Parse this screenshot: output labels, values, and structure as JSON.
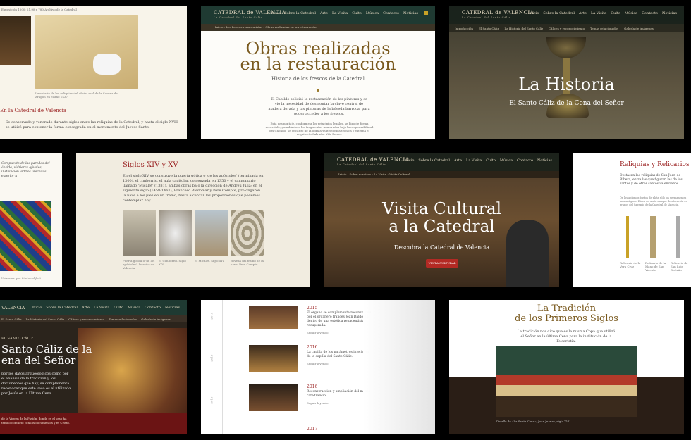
{
  "t1": {
    "crumb": "Exposición 1500: 21.98 x 780 Archivo de la Catedral",
    "heading": "En la Catedral de Valencia",
    "para": "Se conservado y venerado durante siglos entre las reliquias de la Catedral, y hasta el siglo XVIII se utilizó para contener la forma consagrada en el monumento del Jueves Santo.",
    "caption": "Inventario de las reliquias del oficial real de la Corona de Aragón en el año 1437"
  },
  "nav": {
    "logo": "CATEDRAL de VALENCIA",
    "tag": "La Catedral del Santo Cáliz",
    "items": [
      "Inicio",
      "Sobre la Catedral",
      "Arte",
      "La Visita",
      "Culto",
      "Música",
      "Contacto",
      "Noticias"
    ]
  },
  "t2": {
    "crumb": "Inicio › Los frescos renacentistas › Obras realizadas en la restauración",
    "title1": "Obras realizadas",
    "title2": "en la restauración",
    "sub": "Historia de los frescos de la Catedral",
    "p1": "El Cabildo solicitó la restauración de las pinturas y se vio la necesidad de desmontar la clave central de madera dorada y las pinturas de la bóveda barroca, para poder acceder a los frescos.",
    "p2": "Esta desmontaje, conforme a los principios legales, se hizo de forma reversible, guardándose los fragmentos numerados bajo la responsabilidad del Cabildo. Se encargó de la obra arquitectónica técnica y externa el arquitecto Salvador Vila Ferrer."
  },
  "t3": {
    "tabs": [
      "Introducción",
      "El Santo Cáliz",
      "La Historia del Santo Cáliz",
      "Cálices y reconocimiento",
      "Temas relacionados",
      "Galería de imágenes"
    ],
    "title": "La Historia",
    "sub": "El Santo Cáliz de la Cena del Señor"
  },
  "t4": {
    "para": "Compuesto de las paredes del ábside, vidrieras ojivales, instalación vidrios ubicados exterior a",
    "caption": "Vidrieras que Silvia calificó."
  },
  "t5": {
    "title": "Siglos XIV y XV",
    "para": "En el siglo XIV se construye la puerta gótica o 'de los apóstoles' (terminada en 1300), el cimborrio, el aula capitular, comenzada en 1350 y el campanario llamado 'Micalet' (1381), ambas obras bajo la dirección de Andreu Julià; en el siguiente siglo (1458-1467), Francesc Baldomar y Pere Compte, prolongaron la nave a los pies en un tramo, hasta alcanzar las proporciones que podemos contemplar hoy.",
    "captions": [
      "Puerta gótica o 'de los apóstoles'. Interior de Valencia",
      "El Cimborrio. Siglo XIV",
      "El Micalet. Siglo XIV",
      "Bóveda del tramo de la nave. Pere Compte"
    ]
  },
  "t6": {
    "crumb": "Inicio › Sobre nosotros › La Visita › Visita Cultural",
    "title1": "Visita Cultural",
    "title2": "a la Catedral",
    "sub": "Descubra la Catedral de Valencia",
    "button": "VISITA CULTURAL"
  },
  "t7": {
    "title": "Reliquias y Relicarios",
    "para": "Destacan las reliquias de San Juan de Ribera, entre las que figuran las de los santos y de otros santos valencianos.",
    "para2": "De los antiguos bustos de plata sólo los permanentes más antiguos. Dicen un santo aunque de ubicación en granos del Sagrario de la Catedral de Valencia.",
    "captions": [
      "Relicario de la Vera Cruz",
      "Relicario de la Mano de San Vicente",
      "Relicario de San Luis Bertrán"
    ]
  },
  "t8": {
    "logo": "VALENCIA",
    "items": [
      "Inicio",
      "Sobre la Catedral",
      "Arte",
      "La Visita",
      "Culto",
      "Música",
      "Contacto",
      "Noticias"
    ],
    "tabs": [
      "El Santo Cáliz",
      "La Historia del Santo Cáliz",
      "Cálices y reconocimiento",
      "Temas relacionados",
      "Galería de imágenes"
    ],
    "kicker": "EL SANTO CÁLIZ",
    "title1": "Santo Cáliz de la",
    "title2": "ena del Señor",
    "para": "por los datos arqueológicos como por el análisis de la tradición y los documentos que hay, se complementa reconocer que este vaso es el utilizado por Jesús en la Última Cena.",
    "para2": "de la Virgen de la Pasión, donde es el vaso ha tenido contacto con los documentos y es Cristo."
  },
  "t9": {
    "years": [
      "2015",
      "2016",
      "2016",
      "2017"
    ],
    "side": [
      "2015",
      "2016",
      "2016"
    ],
    "items": [
      {
        "year": "2015",
        "text": "El órgano se complementa reconstruido por el organero francés Jean Daldosso dentro de una estética renacentista recuperada."
      },
      {
        "year": "2016",
        "text": "La capilla de los parámetros interiores de la capilla del Santo Cáliz."
      },
      {
        "year": "2016",
        "text": "Reconstrucción y ampliación del museo catedralicio."
      }
    ],
    "more": "Seguir leyendo"
  },
  "t10": {
    "title1": "La Tradición",
    "title2": "de los Primeros Siglos",
    "para": "La tradición nos dice que es la misma Copa que utilizó el Señor en la última Cena para la institución de la Eucaristía.",
    "caption": "Detalle de «La Santa Cena», Joan Juanes, siglo XVI."
  }
}
